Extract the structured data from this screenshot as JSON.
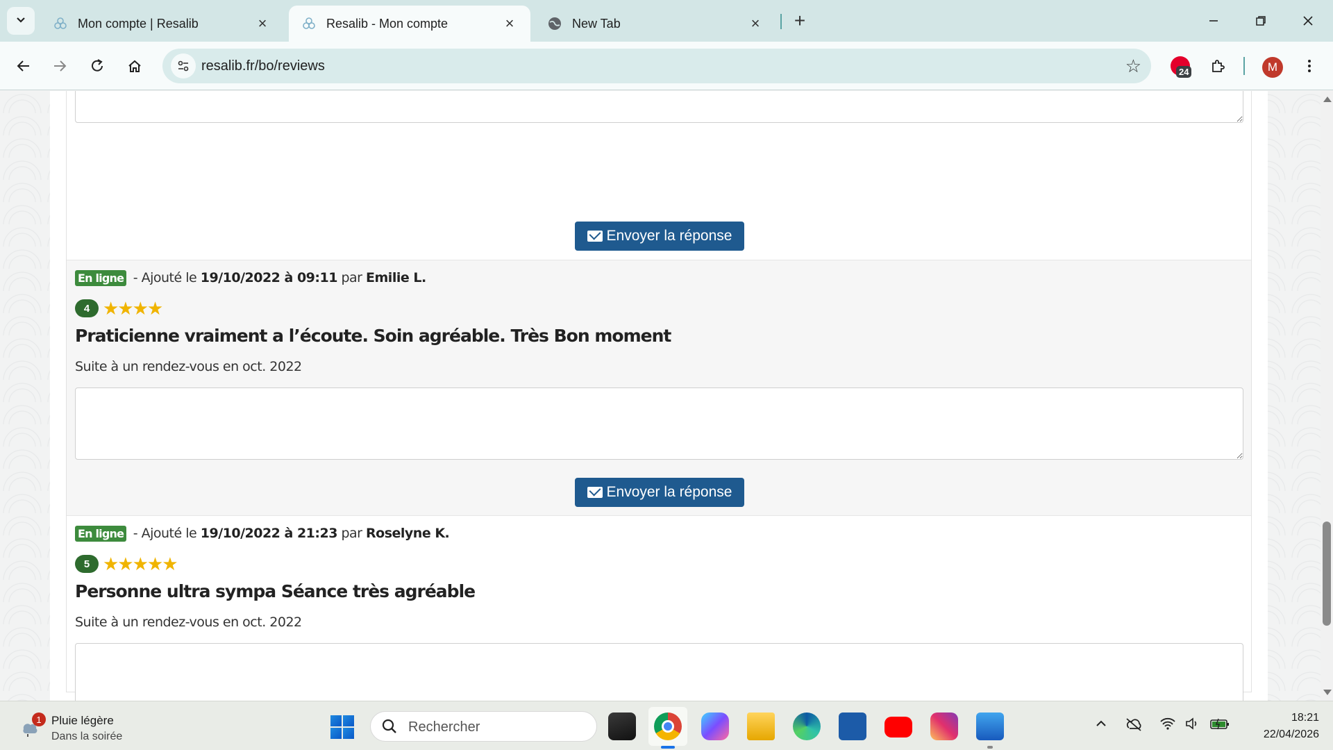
{
  "browser": {
    "tabs": [
      {
        "title": "Mon compte | Resalib",
        "active": false
      },
      {
        "title": "Resalib - Mon compte",
        "active": true
      },
      {
        "title": "New Tab",
        "active": false
      }
    ],
    "url": "resalib.fr/bo/reviews",
    "extension_badge_count": "24",
    "profile_initial": "M"
  },
  "page": {
    "send_label": "Envoyer la réponse",
    "status_label": "En ligne",
    "added_prefix": "- Ajouté le",
    "by_label": "par",
    "reviews": [
      {
        "date": "19/10/2022 à 09:11",
        "author": "Emilie L.",
        "rating": "4",
        "rating_value": 4,
        "stars": "★★★★",
        "title": "Praticienne vraiment a l’écoute. Soin agréable. Très Bon moment",
        "context": "Suite à un rendez-vous en oct. 2022"
      },
      {
        "date": "19/10/2022 à 21:23",
        "author": "Roselyne K.",
        "rating": "5",
        "rating_value": 5,
        "stars": "★★★★★",
        "title": "Personne ultra sympa Séance très agréable",
        "context": "Suite à un rendez-vous en oct. 2022"
      }
    ]
  },
  "taskbar": {
    "weather_badge": "1",
    "weather_line1": "Pluie légère",
    "weather_line2": "Dans la soirée",
    "search_placeholder": "Rechercher",
    "time": "18:21",
    "date": "22/04/2026"
  },
  "colors": {
    "online_badge": "#3d8b3d",
    "rating_badge": "#2e6b2e",
    "star": "#f0b400",
    "send_button": "#1f5a8f"
  }
}
